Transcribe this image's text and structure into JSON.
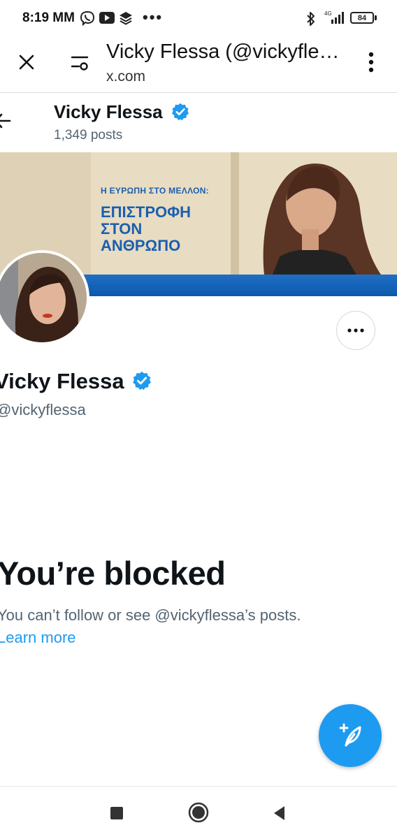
{
  "status_bar": {
    "time": "8:19 MM",
    "battery": "84",
    "network": "4G"
  },
  "browser": {
    "title": "Vicky Flessa (@vickyflessa) / X",
    "url": "x.com"
  },
  "header": {
    "name": "Vicky Flessa",
    "posts": "1,349 posts"
  },
  "banner": {
    "line_small": "Η ΕΥΡΩΠΗ ΣΤΟ ΜΕΛΛΟΝ:",
    "line_1": "ΕΠΙΣΤΡΟΦΗ",
    "line_2": "ΣΤΟΝ",
    "line_3": "ΑΝΘΡΩΠΟ"
  },
  "profile": {
    "name": "Vicky Flessa",
    "handle": "@vickyflessa"
  },
  "blocked": {
    "title": "You’re blocked",
    "message": "You can’t follow or see @vickyflessa’s posts.",
    "learn_more": "Learn more"
  },
  "colors": {
    "accent": "#1d9bf0",
    "text_primary": "#0f1419",
    "text_secondary": "#536471"
  },
  "icons": [
    "close-icon",
    "site-settings-icon",
    "kebab-menu-icon",
    "back-arrow-icon",
    "verified-badge-icon",
    "more-icon",
    "compose-post-icon",
    "recent-apps-icon",
    "home-icon",
    "back-icon"
  ]
}
